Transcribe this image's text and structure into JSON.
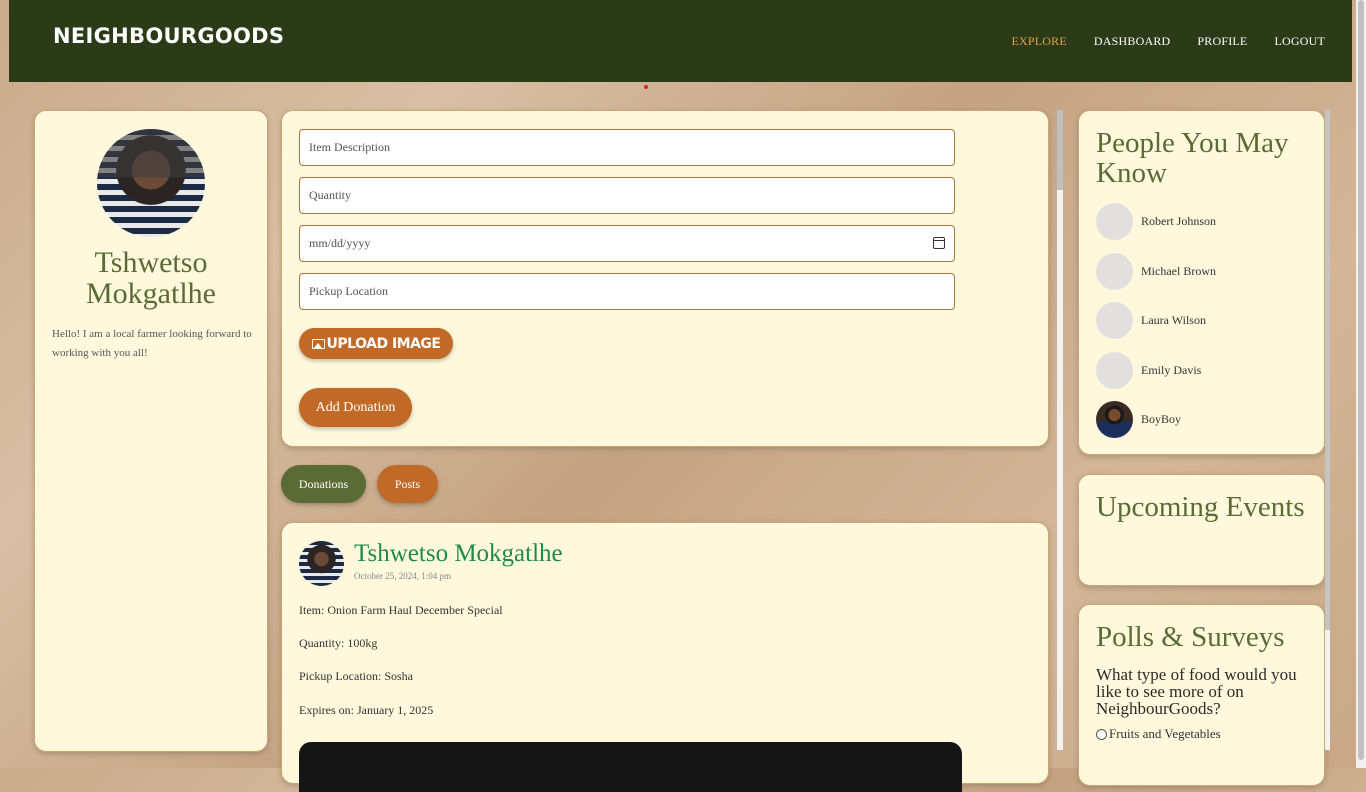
{
  "header": {
    "brand": "NEIGHBOURGOODS",
    "nav": [
      {
        "label": "EXPLORE",
        "active": true
      },
      {
        "label": "DASHBOARD",
        "active": false
      },
      {
        "label": "PROFILE",
        "active": false
      },
      {
        "label": "LOGOUT",
        "active": false
      }
    ]
  },
  "profile": {
    "name": "Tshwetso Mokgatlhe",
    "bio": "Hello! I am a local farmer looking forward to working with you all!"
  },
  "form": {
    "description_placeholder": "Item Description",
    "quantity_placeholder": "Quantity",
    "date_placeholder": "mm/dd/yyyy",
    "location_placeholder": "Pickup Location",
    "upload_label": "UPLOAD IMAGE",
    "add_label": "Add Donation"
  },
  "tabs": {
    "donations": "Donations",
    "posts": "Posts"
  },
  "post": {
    "author": "Tshwetso Mokgatlhe",
    "date": "October 25, 2024, 1:04 pm",
    "item": "Item: Onion Farm Haul December Special",
    "quantity": "Quantity: 100kg",
    "location": "Pickup Location: Sosha",
    "expires": "Expires on: January 1, 2025"
  },
  "people": {
    "title": "People You May Know",
    "list": [
      {
        "name": "Robert Johnson"
      },
      {
        "name": "Michael Brown"
      },
      {
        "name": "Laura Wilson"
      },
      {
        "name": "Emily Davis"
      },
      {
        "name": "BoyBoy"
      }
    ]
  },
  "events": {
    "title": "Upcoming Events"
  },
  "polls": {
    "title": "Polls & Surveys",
    "question": "What type of food would you like to see more of on NeighbourGoods?",
    "options": [
      "Fruits and Vegetables"
    ]
  },
  "colors": {
    "header_bg": "#2b3a17",
    "accent_orange": "#c16a28",
    "accent_olive": "#5b6b35",
    "card_bg": "#fff8dc",
    "author_green": "#1e8a4d"
  }
}
